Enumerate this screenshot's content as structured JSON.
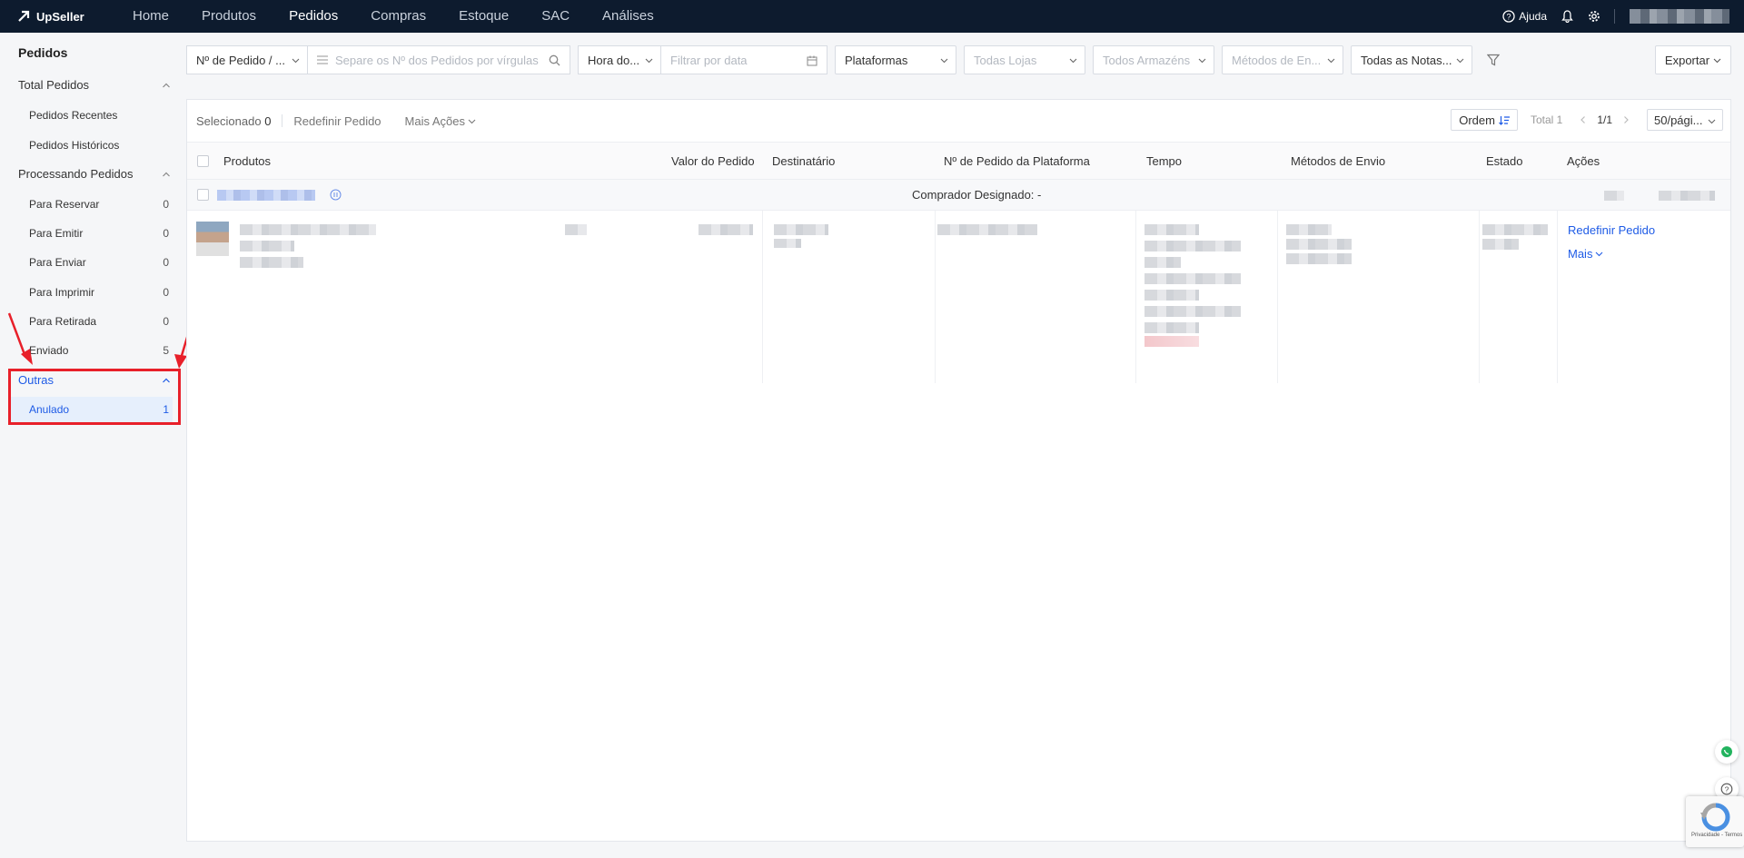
{
  "brand": {
    "name": "UpSeller"
  },
  "nav": {
    "items": [
      {
        "label": "Home",
        "active": false
      },
      {
        "label": "Produtos",
        "active": false
      },
      {
        "label": "Pedidos",
        "active": true
      },
      {
        "label": "Compras",
        "active": false
      },
      {
        "label": "Estoque",
        "active": false
      },
      {
        "label": "SAC",
        "active": false
      },
      {
        "label": "Análises",
        "active": false
      }
    ],
    "help_label": "Ajuda"
  },
  "sidebar": {
    "title": "Pedidos",
    "groups": [
      {
        "label": "Total Pedidos",
        "items": [
          {
            "label": "Pedidos Recentes",
            "count": ""
          },
          {
            "label": "Pedidos Históricos",
            "count": ""
          }
        ]
      },
      {
        "label": "Processando Pedidos",
        "items": [
          {
            "label": "Para Reservar",
            "count": "0"
          },
          {
            "label": "Para Emitir",
            "count": "0"
          },
          {
            "label": "Para Enviar",
            "count": "0"
          },
          {
            "label": "Para Imprimir",
            "count": "0"
          },
          {
            "label": "Para Retirada",
            "count": "0"
          },
          {
            "label": "Enviado",
            "count": "5"
          }
        ]
      },
      {
        "label": "Outras",
        "items": [
          {
            "label": "Anulado",
            "count": "1",
            "active": true
          }
        ]
      }
    ]
  },
  "filters": {
    "order_type": "Nº de Pedido / ...",
    "search_placeholder": "Separe os Nº dos Pedidos por vírgulas",
    "time_type": "Hora do...",
    "date_placeholder": "Filtrar por data",
    "platforms": "Plataformas",
    "stores": "Todas Lojas",
    "warehouses": "Todos Armazéns",
    "shipping": "Métodos de En...",
    "invoices": "Todas as Notas...",
    "export_label": "Exportar"
  },
  "toolbar": {
    "selected_label": "Selecionado",
    "selected_count": "0",
    "reset_label": "Redefinir Pedido",
    "more_actions_label": "Mais Ações",
    "order_label": "Ordem",
    "total_label": "Total 1",
    "page": "1/1",
    "page_size": "50/pági..."
  },
  "table": {
    "headers": {
      "products": "Produtos",
      "value": "Valor do Pedido",
      "recipient": "Destinatário",
      "platform_order": "Nº de Pedido da Plataforma",
      "time": "Tempo",
      "shipping": "Métodos de Envio",
      "status": "Estado",
      "actions": "Ações"
    },
    "order": {
      "buyer_label": "Comprador Designado: -",
      "action_reset": "Redefinir Pedido",
      "action_more": "Mais"
    }
  },
  "colors": {
    "topbar": "#0d1b2e",
    "accent": "#1e5be6",
    "highlight": "#e8202a"
  }
}
